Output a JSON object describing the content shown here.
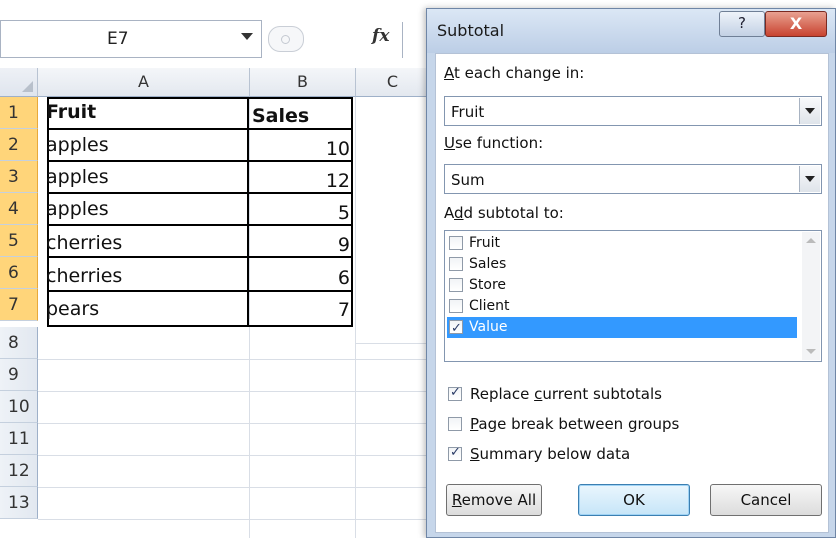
{
  "excel": {
    "name_box": "E7",
    "fx_label": "fx",
    "columns": [
      "A",
      "B",
      "C"
    ],
    "row_numbers": [
      "1",
      "2",
      "3",
      "4",
      "5",
      "6",
      "7",
      "8",
      "9",
      "10",
      "11",
      "12",
      "13"
    ],
    "headers": {
      "a": "Fruit",
      "b": "Sales"
    },
    "rows": [
      {
        "fruit": "apples",
        "sales": "10"
      },
      {
        "fruit": "apples",
        "sales": "12"
      },
      {
        "fruit": "apples",
        "sales": "5"
      },
      {
        "fruit": "cherries",
        "sales": "9"
      },
      {
        "fruit": "cherries",
        "sales": "6"
      },
      {
        "fruit": "pears",
        "sales": "7"
      }
    ]
  },
  "dialog": {
    "title": "Subtotal",
    "help_label": "?",
    "close_label": "X",
    "at_each_change_in": {
      "label_u": "A",
      "label_rest": "t each change in:",
      "value": "Fruit"
    },
    "use_function": {
      "label_u": "U",
      "label_rest": "se function:",
      "value": "Sum"
    },
    "add_subtotal_to": {
      "label_pre": "A",
      "label_u": "d",
      "label_rest": "d subtotal to:"
    },
    "fields": [
      {
        "label": "Fruit",
        "checked": false,
        "selected": false
      },
      {
        "label": "Sales",
        "checked": false,
        "selected": false
      },
      {
        "label": "Store",
        "checked": false,
        "selected": false
      },
      {
        "label": "Client",
        "checked": false,
        "selected": false
      },
      {
        "label": "Value",
        "checked": true,
        "selected": true
      }
    ],
    "options": {
      "replace": {
        "pre": "Replace ",
        "u": "c",
        "rest": "urrent subtotals",
        "checked": true
      },
      "page_break": {
        "pre": "",
        "u": "P",
        "rest": "age break between groups",
        "checked": false
      },
      "summary": {
        "pre": "",
        "u": "S",
        "rest": "ummary below data",
        "checked": true
      }
    },
    "buttons": {
      "remove_all_u": "R",
      "remove_all_rest": "emove All",
      "ok": "OK",
      "cancel": "Cancel"
    }
  }
}
